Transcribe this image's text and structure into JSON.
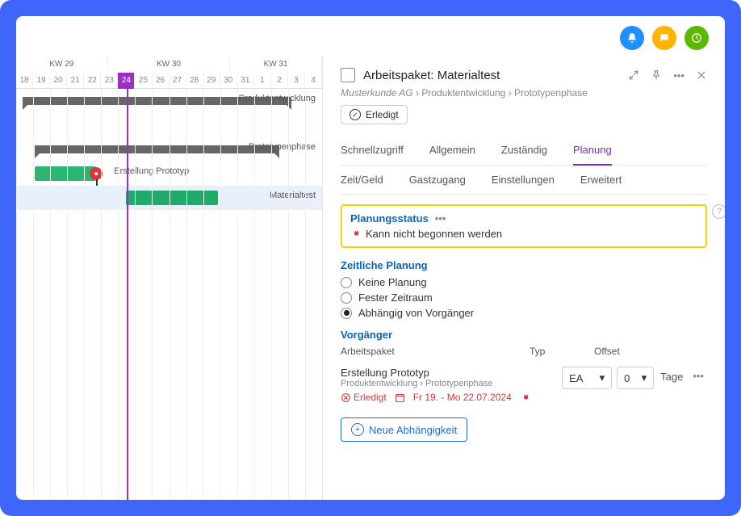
{
  "gantt": {
    "weeks": [
      "KW 29",
      "KW 30",
      "KW 31"
    ],
    "days": [
      "18",
      "19",
      "20",
      "21",
      "22",
      "23",
      "24",
      "25",
      "26",
      "27",
      "28",
      "29",
      "30",
      "31",
      "1",
      "2",
      "3",
      "4"
    ],
    "today_index": 6,
    "rows": [
      {
        "label": "Produktentwicklung"
      },
      {
        "label": "Prototypenphase"
      },
      {
        "label": "Erstellung Prototyp"
      },
      {
        "label": "Materialtest"
      }
    ]
  },
  "panel": {
    "title_prefix": "Arbeitspaket:",
    "title_name": "Materialtest",
    "breadcrumb": [
      "Musterkunde AG",
      "Produktentwicklung",
      "Prototypenphase"
    ],
    "done_label": "Erledigt",
    "tabs_row1": [
      "Schnellzugriff",
      "Allgemein",
      "Zuständig",
      "Planung"
    ],
    "tabs_row2": [
      "Zeit/Geld",
      "Gastzugang",
      "Einstellungen",
      "Erweitert"
    ],
    "active_tab": "Planung",
    "status": {
      "label": "Planungsstatus",
      "value": "Kann nicht begonnen werden"
    },
    "plan_section": {
      "title": "Zeitliche Planung",
      "options": [
        "Keine Planung",
        "Fester Zeitraum",
        "Abhängig von Vorgänger"
      ],
      "selected": 2
    },
    "pred_section": {
      "title": "Vorgänger",
      "cols": {
        "name": "Arbeitspaket",
        "type": "Typ",
        "offset": "Offset"
      },
      "row": {
        "name": "Erstellung Prototyp",
        "path": "Produktentwicklung  ›  Prototypenphase",
        "status_label": "Erledigt",
        "date_range": "Fr 19. - Mo 22.07.2024",
        "type": "EA",
        "offset": "0",
        "unit": "Tage"
      },
      "add_label": "Neue Abhängigkeit"
    }
  }
}
